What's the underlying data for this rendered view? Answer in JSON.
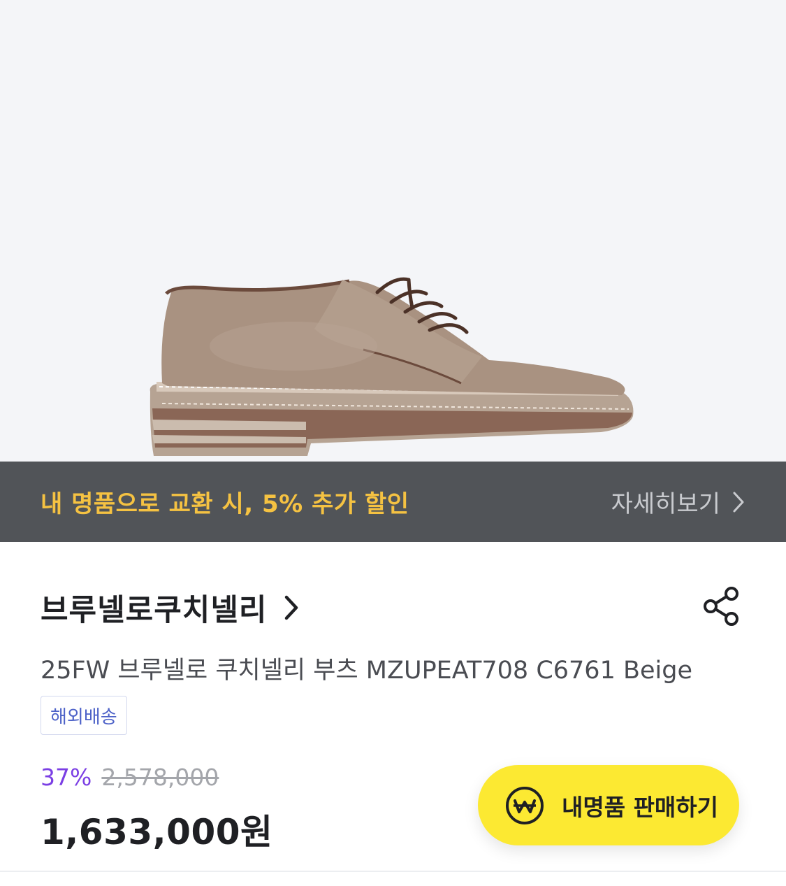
{
  "hero": {
    "image_alt": "베이지 스웨이드 더비 슈즈"
  },
  "promo": {
    "text": "내 명품으로 교환 시, 5% 추가 할인",
    "more_label": "자세히보기",
    "text_color": "#f5c242",
    "bar_color": "#515458"
  },
  "brand": {
    "name": "브루넬로쿠치넬리"
  },
  "product": {
    "title": "25FW 브루넬로 쿠치넬리 부츠 MZUPEAT708 C6761 Beige",
    "badge": "해외배송"
  },
  "price": {
    "discount": "37%",
    "original": "2,578,000",
    "sale": "1,633,000원",
    "discount_color": "#7b3fe4"
  },
  "sell_button": {
    "label": "내명품 판매하기",
    "icon": "won-icon",
    "color": "#fce932"
  },
  "icons": {
    "share": "share-icon",
    "chevron": "chevron-right-icon"
  }
}
